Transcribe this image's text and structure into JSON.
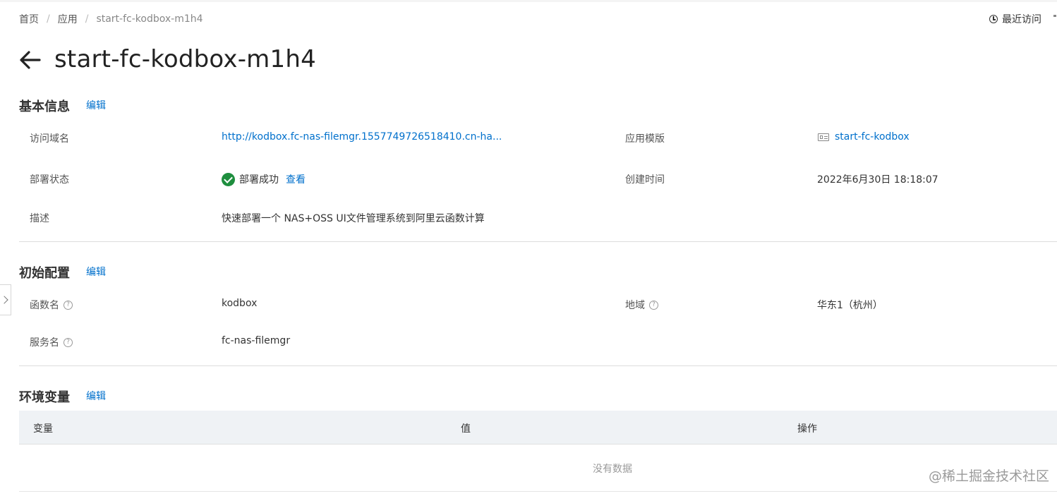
{
  "breadcrumb": {
    "items": [
      "首页",
      "应用"
    ],
    "current": "start-fc-kodbox-m1h4"
  },
  "header": {
    "recent_label": "最近访问",
    "title": "start-fc-kodbox-m1h4"
  },
  "basic_info": {
    "title": "基本信息",
    "edit_label": "编辑",
    "domain_label": "访问域名",
    "domain_value": "http://kodbox.fc-nas-filemgr.1557749726518410.cn-ha...",
    "template_label": "应用模版",
    "template_value": "start-fc-kodbox",
    "deploy_status_label": "部署状态",
    "deploy_status_value": "部署成功",
    "deploy_view_label": "查看",
    "created_label": "创建时间",
    "created_value": "2022年6月30日 18:18:07",
    "desc_label": "描述",
    "desc_value": "快速部署一个 NAS+OSS UI文件管理系统到阿里云函数计算"
  },
  "initial_config": {
    "title": "初始配置",
    "edit_label": "编辑",
    "function_label": "函数名",
    "function_value": "kodbox",
    "region_label": "地域",
    "region_value": "华东1（杭州）",
    "service_label": "服务名",
    "service_value": "fc-nas-filemgr"
  },
  "env_vars": {
    "title": "环境变量",
    "edit_label": "编辑",
    "columns": [
      "变量",
      "值",
      "操作"
    ],
    "empty_text": "没有数据"
  },
  "help_glyph": "?",
  "watermark": "@稀土掘金技术社区",
  "colors": {
    "link": "#0070cc",
    "success": "#1e8e3e",
    "table_header_bg": "#eff2f5"
  }
}
